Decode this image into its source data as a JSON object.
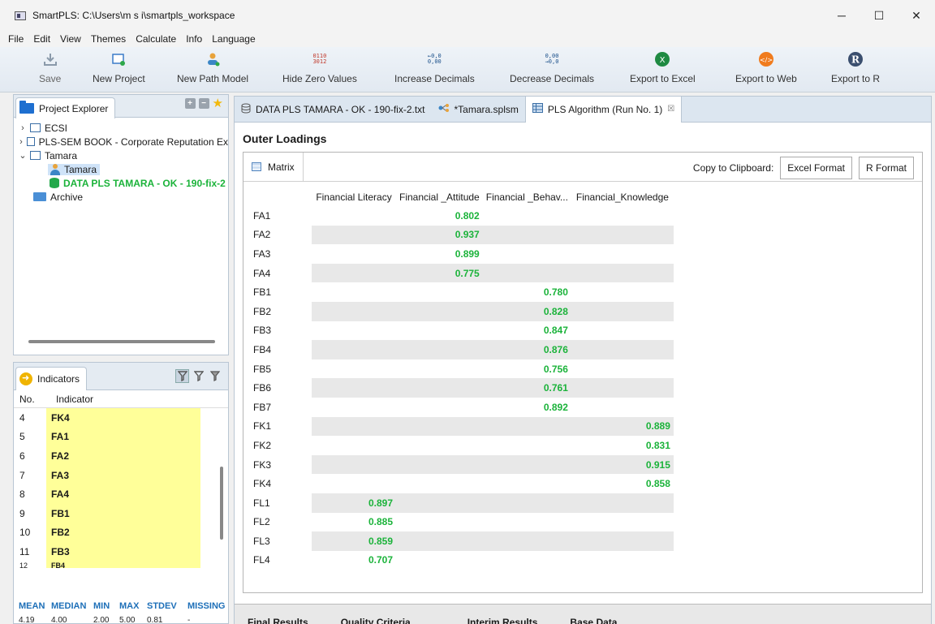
{
  "window": {
    "title": "SmartPLS: C:\\Users\\m s i\\smartpls_workspace"
  },
  "menu": [
    "File",
    "Edit",
    "View",
    "Themes",
    "Calculate",
    "Info",
    "Language"
  ],
  "toolbar": {
    "save": "Save",
    "new_project": "New Project",
    "new_path_model": "New Path Model",
    "hide_zero": "Hide Zero Values",
    "increase_decimals": "Increase Decimals",
    "decrease_decimals": "Decrease Decimals",
    "export_excel": "Export to Excel",
    "export_web": "Export to Web",
    "export_r": "Export to R"
  },
  "project_explorer": {
    "tab_label": "Project Explorer",
    "items": {
      "ecsi": "ECSI",
      "plssem": "PLS-SEM BOOK - Corporate Reputation Ex",
      "tamara": "Tamara",
      "tamara_model": "Tamara",
      "data_file": "DATA PLS TAMARA - OK - 190-fix-2",
      "archive": "Archive"
    }
  },
  "indicators": {
    "tab_label": "Indicators",
    "col_no": "No.",
    "col_indicator": "Indicator",
    "rows": [
      {
        "no": "4",
        "name": "FK4"
      },
      {
        "no": "5",
        "name": "FA1"
      },
      {
        "no": "6",
        "name": "FA2"
      },
      {
        "no": "7",
        "name": "FA3"
      },
      {
        "no": "8",
        "name": "FA4"
      },
      {
        "no": "9",
        "name": "FB1"
      },
      {
        "no": "10",
        "name": "FB2"
      },
      {
        "no": "11",
        "name": "FB3"
      },
      {
        "no": "12",
        "name": "FB4"
      }
    ],
    "stats_labels": {
      "mean": "MEAN",
      "median": "MEDIAN",
      "min": "MIN",
      "max": "MAX",
      "stdev": "STDEV",
      "missing": "MISSING"
    },
    "stats_values": {
      "mean": "4.19",
      "median": "4.00",
      "min": "2.00",
      "max": "5.00",
      "stdev": "0.81",
      "missing": "-"
    }
  },
  "editor_tabs": {
    "tab1": "DATA PLS TAMARA - OK - 190-fix-2.txt",
    "tab2": "*Tamara.splsm",
    "tab3": "PLS Algorithm (Run No. 1)",
    "close_symbol": "☒"
  },
  "outer_loadings": {
    "title": "Outer Loadings",
    "matrix_tab": "Matrix",
    "copy_label": "Copy to Clipboard:",
    "excel_format": "Excel Format",
    "r_format": "R Format",
    "columns": [
      "Financial Literacy",
      "Financial _Attitude",
      "Financial _Behav...",
      "Financial_Knowledge"
    ],
    "rows": [
      {
        "label": "FA1",
        "values": [
          "",
          "0.802",
          "",
          ""
        ]
      },
      {
        "label": "FA2",
        "values": [
          "",
          "0.937",
          "",
          ""
        ]
      },
      {
        "label": "FA3",
        "values": [
          "",
          "0.899",
          "",
          ""
        ]
      },
      {
        "label": "FA4",
        "values": [
          "",
          "0.775",
          "",
          ""
        ]
      },
      {
        "label": "FB1",
        "values": [
          "",
          "",
          "0.780",
          ""
        ]
      },
      {
        "label": "FB2",
        "values": [
          "",
          "",
          "0.828",
          ""
        ]
      },
      {
        "label": "FB3",
        "values": [
          "",
          "",
          "0.847",
          ""
        ]
      },
      {
        "label": "FB4",
        "values": [
          "",
          "",
          "0.876",
          ""
        ]
      },
      {
        "label": "FB5",
        "values": [
          "",
          "",
          "0.756",
          ""
        ]
      },
      {
        "label": "FB6",
        "values": [
          "",
          "",
          "0.761",
          ""
        ]
      },
      {
        "label": "FB7",
        "values": [
          "",
          "",
          "0.892",
          ""
        ]
      },
      {
        "label": "FK1",
        "values": [
          "",
          "",
          "",
          "0.889"
        ]
      },
      {
        "label": "FK2",
        "values": [
          "",
          "",
          "",
          "0.831"
        ]
      },
      {
        "label": "FK3",
        "values": [
          "",
          "",
          "",
          "0.915"
        ]
      },
      {
        "label": "FK4",
        "values": [
          "",
          "",
          "",
          "0.858"
        ]
      },
      {
        "label": "FL1",
        "values": [
          "0.897",
          "",
          "",
          ""
        ]
      },
      {
        "label": "FL2",
        "values": [
          "0.885",
          "",
          "",
          ""
        ]
      },
      {
        "label": "FL3",
        "values": [
          "0.859",
          "",
          "",
          ""
        ]
      },
      {
        "label": "FL4",
        "values": [
          "0.707",
          "",
          "",
          ""
        ]
      }
    ]
  },
  "bottom_tabs": [
    "Final Results",
    "Quality Criteria",
    "Interim Results",
    "Base Data"
  ],
  "colors": {
    "value_green": "#1bb33a",
    "indicator_yellow": "#ffff99",
    "stats_blue": "#1d6fb8"
  }
}
